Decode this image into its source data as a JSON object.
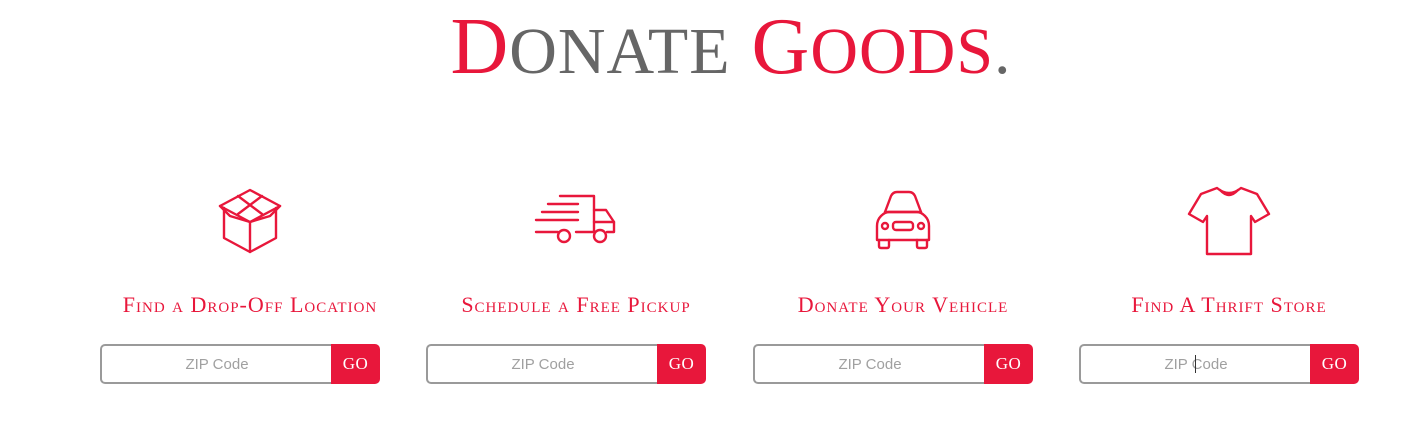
{
  "header": {
    "title_word1_initial": "D",
    "title_word1_rest": "ONATE",
    "title_word2_initial": "G",
    "title_word2_rest": "OODS",
    "title_period": "."
  },
  "colors": {
    "accent": "#e8173b",
    "title_gray": "#666666",
    "input_border": "#9a9a9a"
  },
  "cards": [
    {
      "icon": "box-icon",
      "title": "Find a Drop-Off Location",
      "zip_placeholder": "ZIP Code",
      "zip_value": "",
      "button_label": "GO"
    },
    {
      "icon": "truck-icon",
      "title": "Schedule a Free Pickup",
      "zip_placeholder": "ZIP Code",
      "zip_value": "",
      "button_label": "GO"
    },
    {
      "icon": "car-icon",
      "title": "Donate Your Vehicle",
      "zip_placeholder": "ZIP Code",
      "zip_value": "",
      "button_label": "GO"
    },
    {
      "icon": "tshirt-icon",
      "title": "Find A Thrift Store",
      "zip_placeholder": "ZIP Code",
      "zip_value": "",
      "button_label": "GO"
    }
  ]
}
